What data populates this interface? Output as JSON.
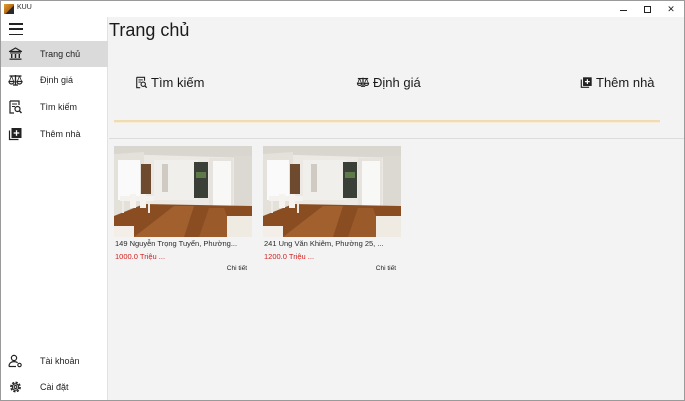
{
  "window": {
    "title": "KUU",
    "controls": {
      "minimize": "",
      "maximize": "",
      "close": "✕"
    }
  },
  "sidebar": {
    "items": [
      {
        "label": "Trang chủ",
        "icon": "bank-icon",
        "active": true
      },
      {
        "label": "Định giá",
        "icon": "scale-icon",
        "active": false
      },
      {
        "label": "Tìm kiếm",
        "icon": "search-document-icon",
        "active": false
      },
      {
        "label": "Thêm nhà",
        "icon": "add-box-icon",
        "active": false
      }
    ],
    "footer_items": [
      {
        "label": "Tài khoản",
        "icon": "account-icon"
      },
      {
        "label": "Cài đặt",
        "icon": "settings-icon"
      }
    ]
  },
  "main": {
    "page_title": "Trang chủ",
    "quick_actions": [
      {
        "label": "Tìm kiếm",
        "icon": "search-document-icon"
      },
      {
        "label": "Định giá",
        "icon": "scale-icon"
      },
      {
        "label": "Thêm nhà",
        "icon": "add-box-icon"
      }
    ],
    "accent_color": "#f0dcb2",
    "listings": [
      {
        "address": "149 Nguyễn Trọng Tuyển, Phường...",
        "price": "1000.0 Triệu ...",
        "detail_label": "Chi tiết"
      },
      {
        "address": "241 Ung Văn Khiêm, Phường 25, ...",
        "price": "1200.0 Triệu ...",
        "detail_label": "Chi tiết"
      }
    ],
    "price_color": "#d21e1e"
  }
}
